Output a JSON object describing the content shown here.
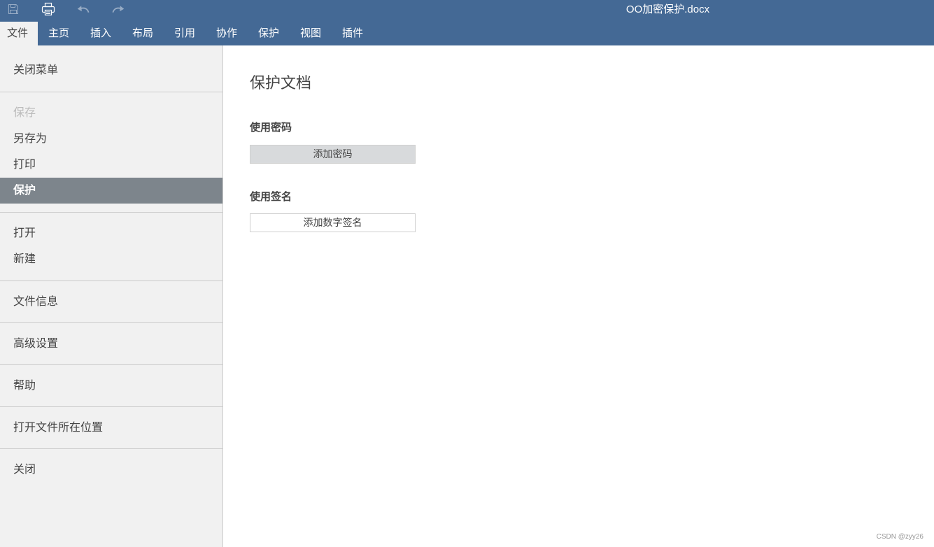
{
  "header": {
    "document_title": "OO加密保护.docx",
    "quick_access": [
      {
        "icon": "save-icon",
        "disabled": true
      },
      {
        "icon": "print-icon",
        "disabled": false
      },
      {
        "icon": "undo-icon",
        "disabled": true
      },
      {
        "icon": "redo-icon",
        "disabled": true
      }
    ],
    "tabs": [
      {
        "label": "文件",
        "active": true
      },
      {
        "label": "主页",
        "active": false
      },
      {
        "label": "插入",
        "active": false
      },
      {
        "label": "布局",
        "active": false
      },
      {
        "label": "引用",
        "active": false
      },
      {
        "label": "协作",
        "active": false
      },
      {
        "label": "保护",
        "active": false
      },
      {
        "label": "视图",
        "active": false
      },
      {
        "label": "插件",
        "active": false
      }
    ]
  },
  "file_menu": {
    "groups": [
      {
        "items": [
          {
            "label": "关闭菜单"
          }
        ]
      },
      {
        "items": [
          {
            "label": "保存",
            "disabled": true
          },
          {
            "label": "另存为"
          },
          {
            "label": "打印"
          },
          {
            "label": "保护",
            "selected": true
          }
        ]
      },
      {
        "items": [
          {
            "label": "打开"
          },
          {
            "label": "新建"
          }
        ]
      },
      {
        "items": [
          {
            "label": "文件信息"
          }
        ]
      },
      {
        "items": [
          {
            "label": "高级设置"
          }
        ]
      },
      {
        "items": [
          {
            "label": "帮助"
          }
        ]
      },
      {
        "items": [
          {
            "label": "打开文件所在位置"
          }
        ]
      },
      {
        "items": [
          {
            "label": "关闭"
          }
        ]
      }
    ]
  },
  "protect_panel": {
    "title": "保护文档",
    "password": {
      "heading": "使用密码",
      "button_label": "添加密码"
    },
    "signature": {
      "heading": "使用签名",
      "button_label": "添加数字签名"
    }
  },
  "watermark": "CSDN @zyy26",
  "colors": {
    "header_background": "#446995",
    "menu_background": "#f1f1f1",
    "menu_selected_background": "#7d858c",
    "text": "#444444",
    "disabled_text": "#bbbbbb",
    "password_button_background": "#d8dadc"
  }
}
